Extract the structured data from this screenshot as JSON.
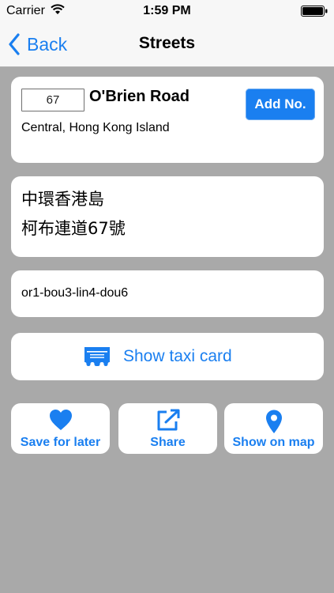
{
  "status_bar": {
    "carrier": "Carrier",
    "time": "1:59 PM"
  },
  "nav": {
    "back_label": "Back",
    "title": "Streets"
  },
  "address": {
    "number_value": "67",
    "street_name": "O'Brien Road",
    "district": "Central, Hong Kong Island",
    "add_no_label": "Add No."
  },
  "chinese": {
    "line1": "中環香港島",
    "line2": "柯布連道67號"
  },
  "romanization": {
    "text": "or1-bou3-lin4-dou6"
  },
  "taxi_card": {
    "label": "Show taxi card",
    "icon": "ticket-icon"
  },
  "actions": [
    {
      "label": "Save for later",
      "icon": "heart-icon"
    },
    {
      "label": "Share",
      "icon": "share-icon"
    },
    {
      "label": "Show on map",
      "icon": "map-pin-icon"
    }
  ],
  "colors": {
    "accent": "#1a7ff0",
    "background": "#a9a9a9",
    "card": "#ffffff",
    "bar": "#f7f7f7"
  }
}
